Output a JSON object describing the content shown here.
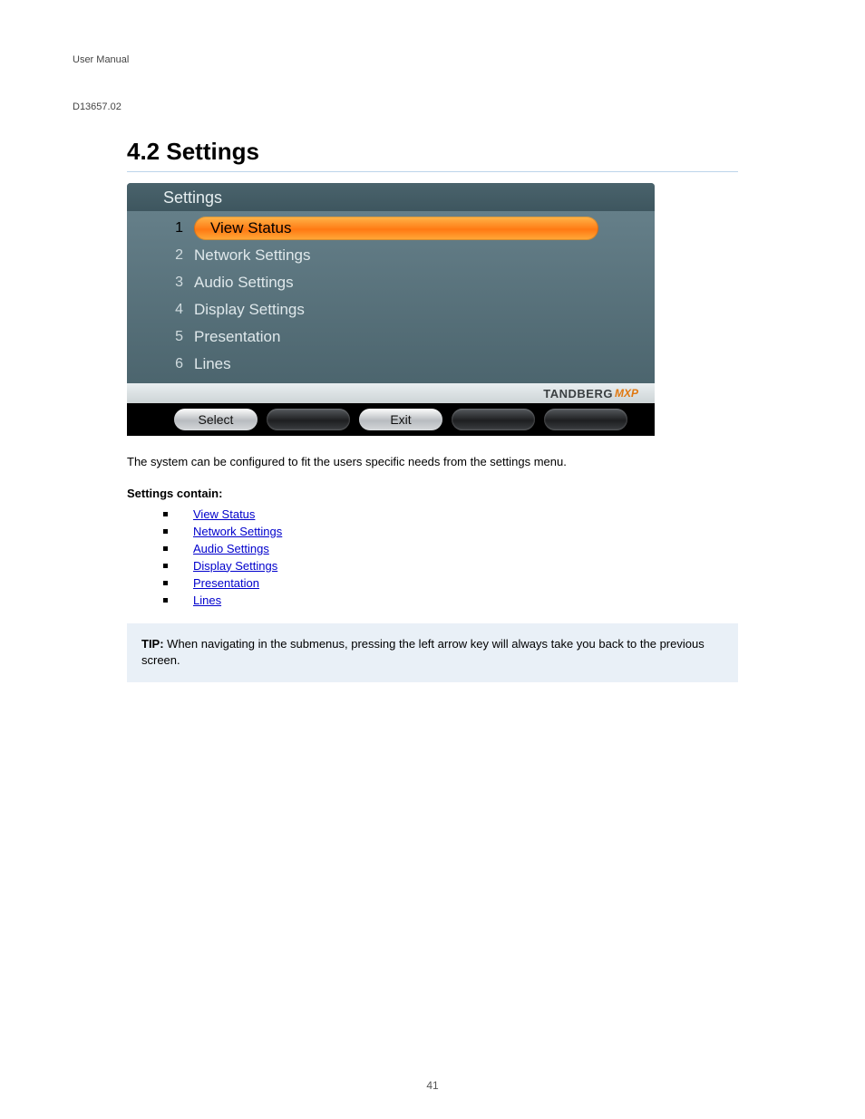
{
  "header": "User Manual",
  "doc_number": "D13657.02",
  "section_title": "4.2 Settings",
  "panel": {
    "title": "Settings",
    "items": [
      {
        "num": "1",
        "label": "View Status",
        "selected": true
      },
      {
        "num": "2",
        "label": "Network Settings",
        "selected": false
      },
      {
        "num": "3",
        "label": "Audio Settings",
        "selected": false
      },
      {
        "num": "4",
        "label": "Display Settings",
        "selected": false
      },
      {
        "num": "5",
        "label": "Presentation",
        "selected": false
      },
      {
        "num": "6",
        "label": "Lines",
        "selected": false
      }
    ],
    "brand_main": "TANDBERG",
    "brand_sub": "MXP",
    "buttons": [
      {
        "label": "Select",
        "style": "light"
      },
      {
        "label": "",
        "style": "dark"
      },
      {
        "label": "Exit",
        "style": "light"
      },
      {
        "label": "",
        "style": "dark"
      },
      {
        "label": "",
        "style": "dark"
      }
    ]
  },
  "intro": "The system can be configured to fit the users specific needs from the settings menu.",
  "subhead": "Settings contain:",
  "links": [
    "View Status",
    "Network Settings",
    "Audio Settings",
    "Display Settings",
    "Presentation",
    "Lines"
  ],
  "tip": {
    "label": "TIP:",
    "text": " When navigating in the submenus, pressing the left arrow key will always take you back to the previous screen."
  },
  "page_num": "41"
}
